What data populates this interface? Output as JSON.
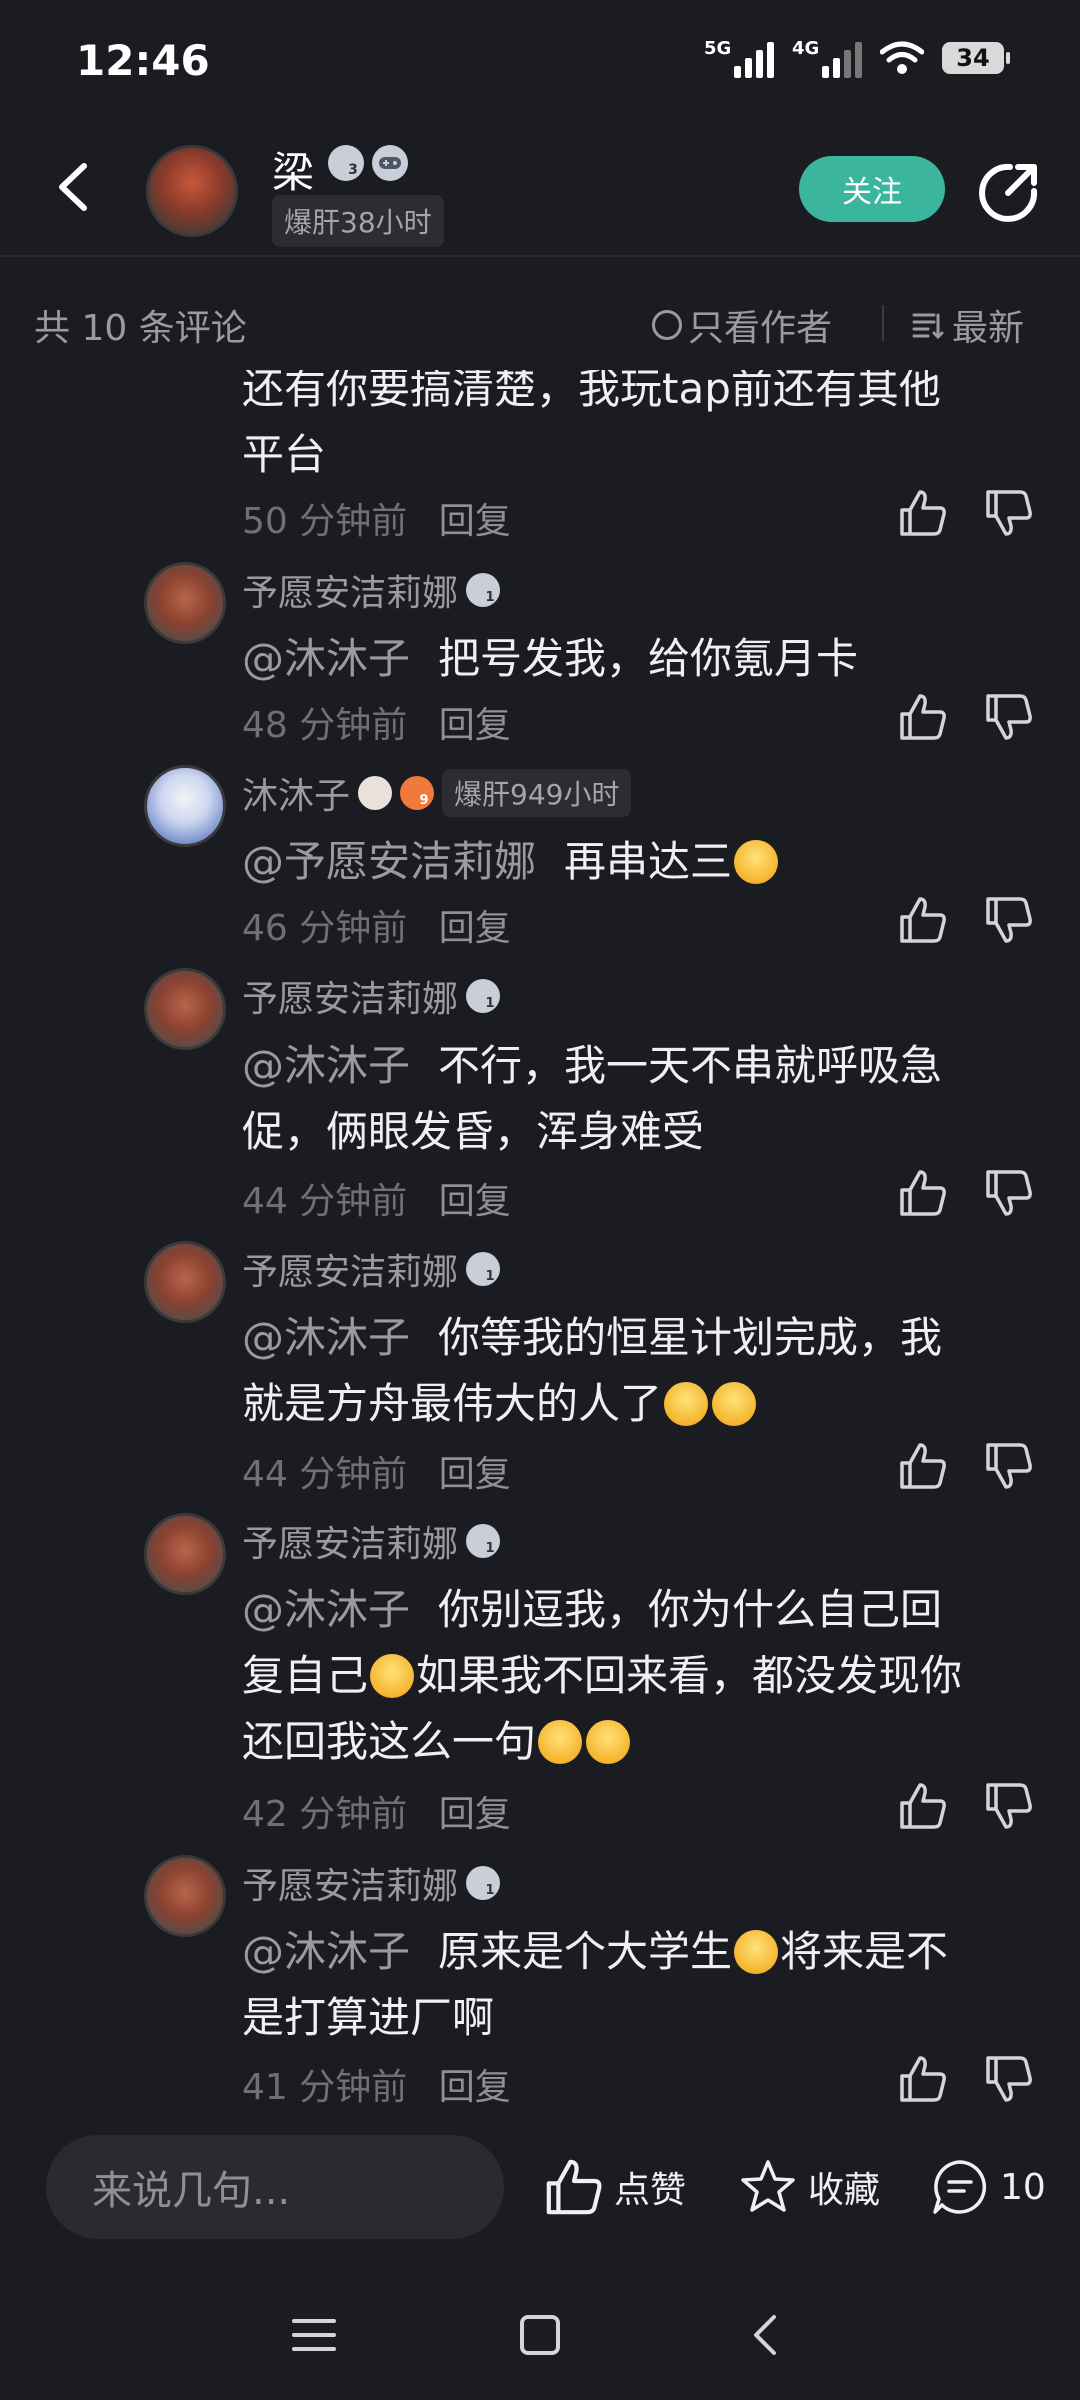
{
  "status_bar": {
    "time": "12:46",
    "sim1": "5G",
    "sim2": "4G",
    "battery": "34"
  },
  "header": {
    "author_name": "梁",
    "badge_level": "3",
    "hours_tag": "爆肝38小时",
    "follow_label": "关注"
  },
  "filter_bar": {
    "count_text": "共 10 条评论",
    "only_author_label": "只看作者",
    "sort_label": "最新"
  },
  "comments": [
    {
      "type": "main",
      "lines": [
        "还有你要搞清楚，我玩tap前还有其他",
        "平台"
      ],
      "time": "50 分钟前",
      "reply_label": "回复"
    },
    {
      "type": "reply",
      "name": "予愿安洁莉娜",
      "level": "1",
      "mention": "@沐沐子",
      "text": "把号发我，给你氪月卡",
      "time": "48 分钟前",
      "reply_label": "回复"
    },
    {
      "type": "reply",
      "name": "沐沐子",
      "level": "9",
      "hours_tag": "爆肝949小时",
      "mention": "@予愿安洁莉娜",
      "text": "再串达三",
      "time": "46 分钟前",
      "reply_label": "回复"
    },
    {
      "type": "reply",
      "name": "予愿安洁莉娜",
      "level": "1",
      "mention": "@沐沐子",
      "text": "不行，我一天不串就呼吸急",
      "text2": "促，俩眼发昏，浑身难受",
      "time": "44 分钟前",
      "reply_label": "回复"
    },
    {
      "type": "reply",
      "name": "予愿安洁莉娜",
      "level": "1",
      "mention": "@沐沐子",
      "text": "你等我的恒星计划完成，我",
      "text2": "就是方舟最伟大的人了",
      "time": "44 分钟前",
      "reply_label": "回复"
    },
    {
      "type": "reply",
      "name": "予愿安洁莉娜",
      "level": "1",
      "mention": "@沐沐子",
      "text": "你别逗我，你为什么自己回",
      "text2a": "复自己",
      "text2b": "如果我不回来看，都没发现你",
      "text3": "还回我这么一句",
      "time": "42 分钟前",
      "reply_label": "回复"
    },
    {
      "type": "reply",
      "name": "予愿安洁莉娜",
      "level": "1",
      "mention": "@沐沐子",
      "text": "原来是个大学生",
      "text_b": "将来是不",
      "text2": "是打算进厂啊",
      "time": "41 分钟前",
      "reply_label": "回复"
    }
  ],
  "bottom_bar": {
    "input_placeholder": "来说几句...",
    "like_label": "点赞",
    "fav_label": "收藏",
    "comment_count": "10"
  },
  "colors": {
    "background": "#1b1c21",
    "accent": "#3cb59f",
    "muted": "#9a9ba1"
  }
}
